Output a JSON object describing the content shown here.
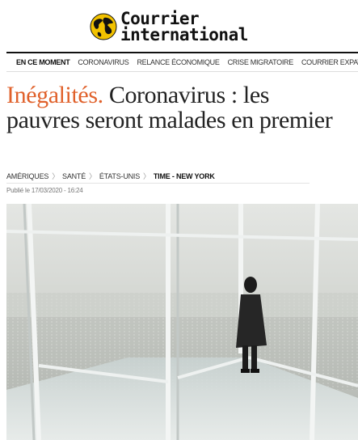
{
  "brand": {
    "line1": "Courrier",
    "line2": "international"
  },
  "nav": {
    "current": "EN CE MOMENT",
    "items": [
      "CORONAVIRUS",
      "RELANCE ÉCONOMIQUE",
      "CRISE MIGRATOIRE",
      "COURRIER EXPAT"
    ]
  },
  "article": {
    "kicker": "Inégalités.",
    "title": "Coronavirus : les pauvres seront malades en premier",
    "breadcrumb": [
      "AMÉRIQUES",
      "SANTÉ",
      "ÉTATS-UNIS"
    ],
    "source": "TIME - NEW YORK",
    "published": "Publié le 17/03/2020 - 16:24"
  },
  "colors": {
    "accent": "#e0612b",
    "sky": "#d9dcd8",
    "city": "#b7bbb6",
    "frame": "#eef1f0"
  }
}
